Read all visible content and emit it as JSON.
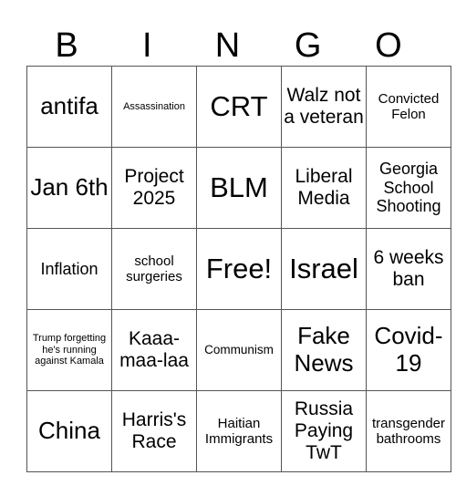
{
  "header": [
    "B",
    "I",
    "N",
    "G",
    "O"
  ],
  "rows": [
    [
      "antifa",
      "Assassination",
      "CRT",
      "Walz not a veteran",
      "Convicted Felon"
    ],
    [
      "Jan 6th",
      "Project 2025",
      "BLM",
      "Liberal Media",
      "Georgia School Shooting"
    ],
    [
      "Inflation",
      "school surgeries",
      "Free!",
      "Israel",
      "6 weeks ban"
    ],
    [
      "Trump forgetting he's running against Kamala",
      "Kaaa-maa-laa",
      "Communism",
      "Fake News",
      "Covid-19"
    ],
    [
      "China",
      "Harris's Race",
      "Haitian Immigrants",
      "Russia Paying TwT",
      "transgender bathrooms"
    ]
  ]
}
